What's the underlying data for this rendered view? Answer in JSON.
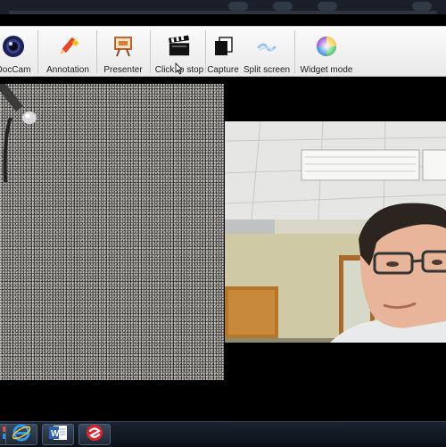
{
  "toolbar": {
    "items": [
      {
        "label": "DocCam",
        "icon": "webcam-icon"
      },
      {
        "label": "Annotation",
        "icon": "pencil-icon"
      },
      {
        "label": "Presenter",
        "icon": "presenter-easel-icon"
      },
      {
        "label": "Click to stop",
        "icon": "clapperboard-icon"
      },
      {
        "label": "Capture",
        "icon": "capture-icon"
      },
      {
        "label": "Split screen",
        "icon": "split-screen-icon"
      },
      {
        "label": "Widget mode",
        "icon": "color-wheel-icon"
      }
    ]
  },
  "taskbar": {
    "apps": [
      {
        "icon": "windows-start-icon"
      },
      {
        "icon": "internet-explorer-icon"
      },
      {
        "icon": "word-icon"
      },
      {
        "icon": "app-red-swirl-icon"
      }
    ]
  },
  "colors": {
    "toolbar_bg": "#f2f2f2",
    "taskbar_bg": "#131a24",
    "background": "#000000"
  }
}
